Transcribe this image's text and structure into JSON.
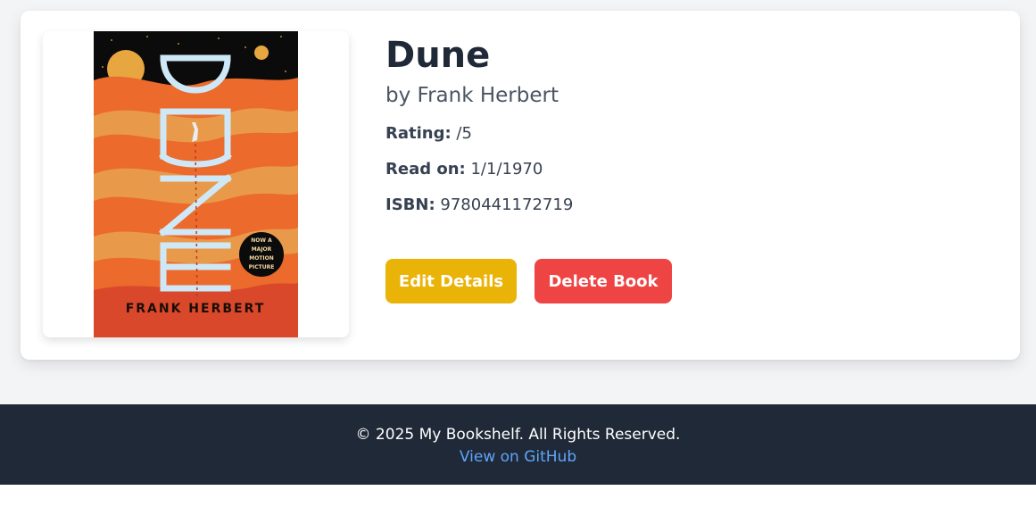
{
  "book": {
    "title": "Dune",
    "author_line": "by Frank Herbert",
    "cover": {
      "title_text": "DUNE",
      "author_text": "FRANK HERBERT",
      "badge_lines": [
        "NOW A",
        "MAJOR",
        "MOTION",
        "PICTURE"
      ],
      "colors": {
        "sky": "#0b0b0b",
        "sand_light": "#e89a4a",
        "sand_mid": "#ec6a2c",
        "sand_dark": "#d9482a",
        "sun": "#e8a640",
        "letters": "#cfe8f7"
      }
    },
    "rating": {
      "label": "Rating:",
      "value": "/5"
    },
    "read_on": {
      "label": "Read on:",
      "value": "1/1/1970"
    },
    "isbn": {
      "label": "ISBN:",
      "value": "9780441172719"
    }
  },
  "actions": {
    "edit_label": "Edit Details",
    "delete_label": "Delete Book"
  },
  "footer": {
    "copyright": "© 2025 My Bookshelf. All Rights Reserved.",
    "link_text": "View on GitHub"
  },
  "colors": {
    "edit_button": "#eab308",
    "delete_button": "#ef4444",
    "footer_bg": "#1f2937",
    "link": "#60a5fa"
  }
}
